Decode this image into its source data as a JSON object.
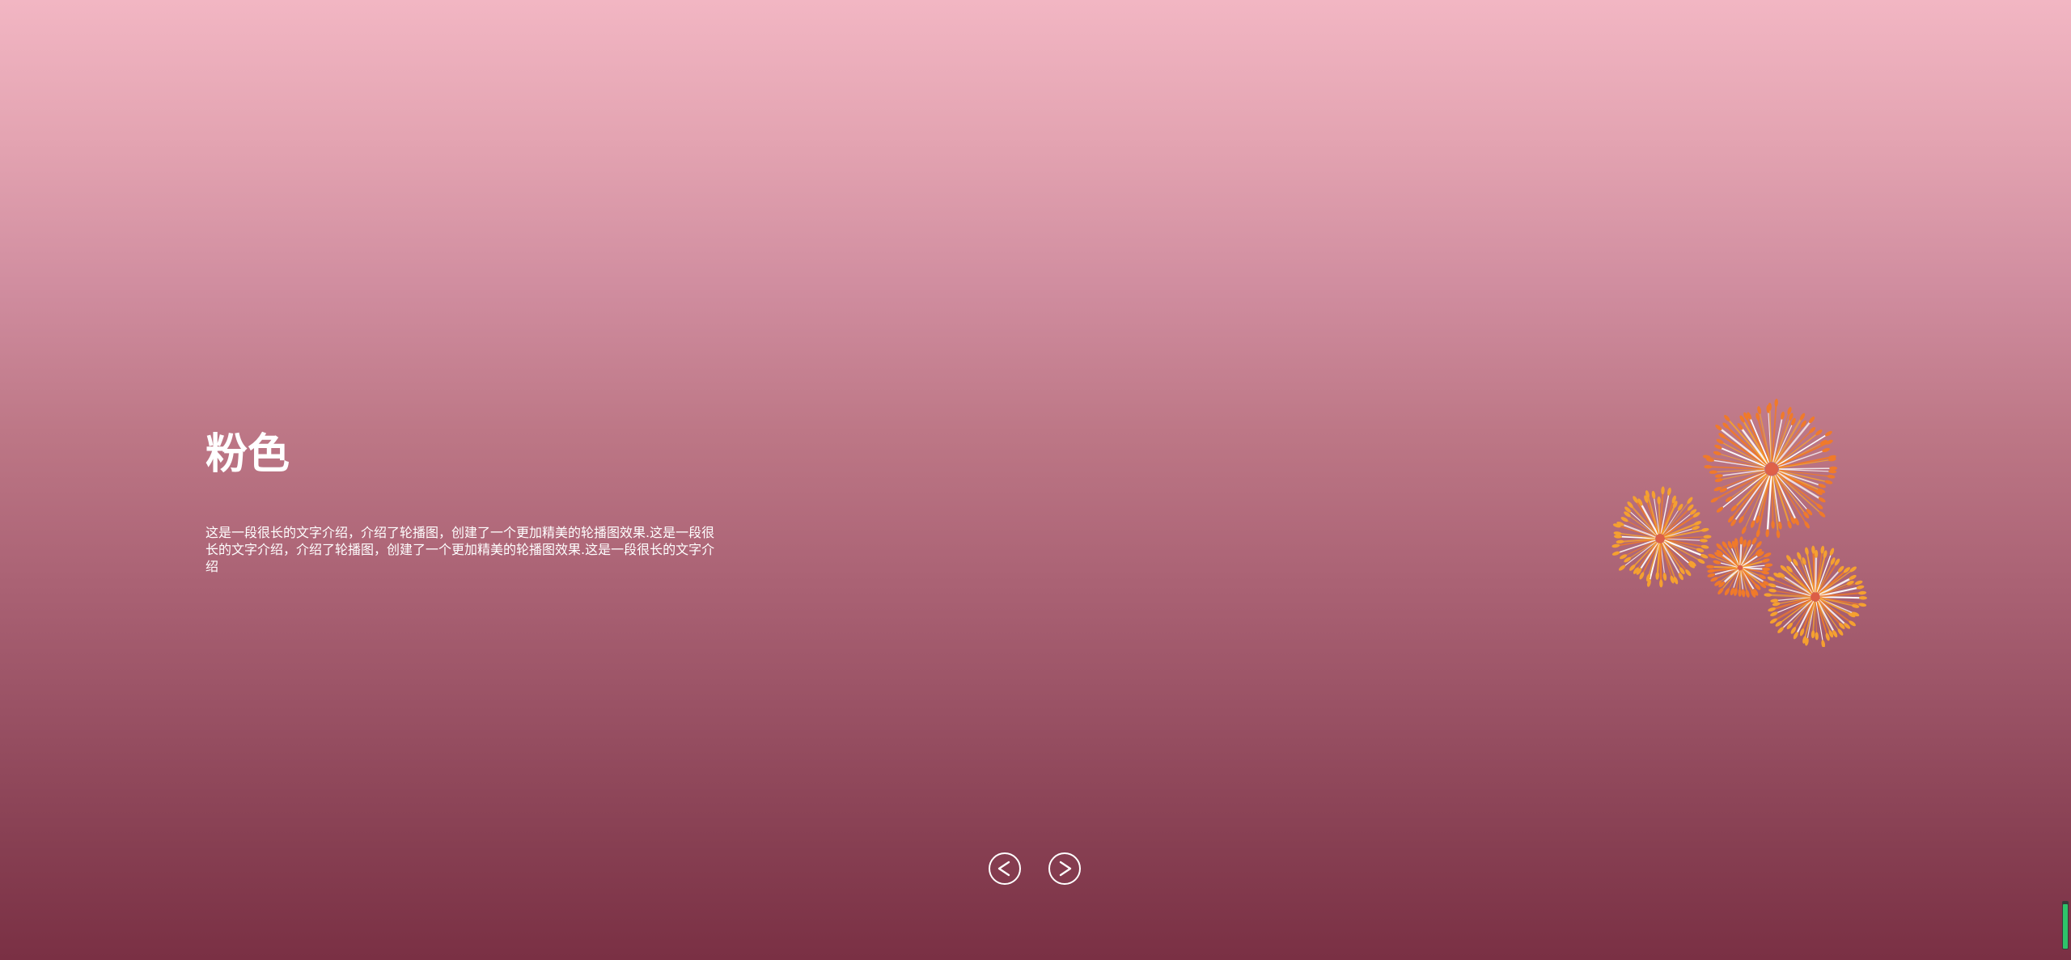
{
  "slide": {
    "title": "粉色",
    "description": "这是一段很长的文字介绍，介绍了轮播图，创建了一个更加精美的轮播图效果.这是一段很长的文字介绍，介绍了轮播图，创建了一个更加精美的轮播图效果.这是一段很长的文字介绍"
  },
  "controls": {
    "prev_label": "<",
    "next_label": ">"
  },
  "decor": {
    "fireworks_icon": "fireworks-icon",
    "firework_colors": [
      "#f07a2a",
      "#f5a030",
      "#ffffff",
      "#e85d3b"
    ]
  },
  "theme": {
    "gradient_top": "#f2b6c3",
    "gradient_bottom": "#7a3044",
    "text_color": "#ffffff",
    "indicator_color": "#2ec46a"
  },
  "indicator": {
    "level": 0.92
  }
}
